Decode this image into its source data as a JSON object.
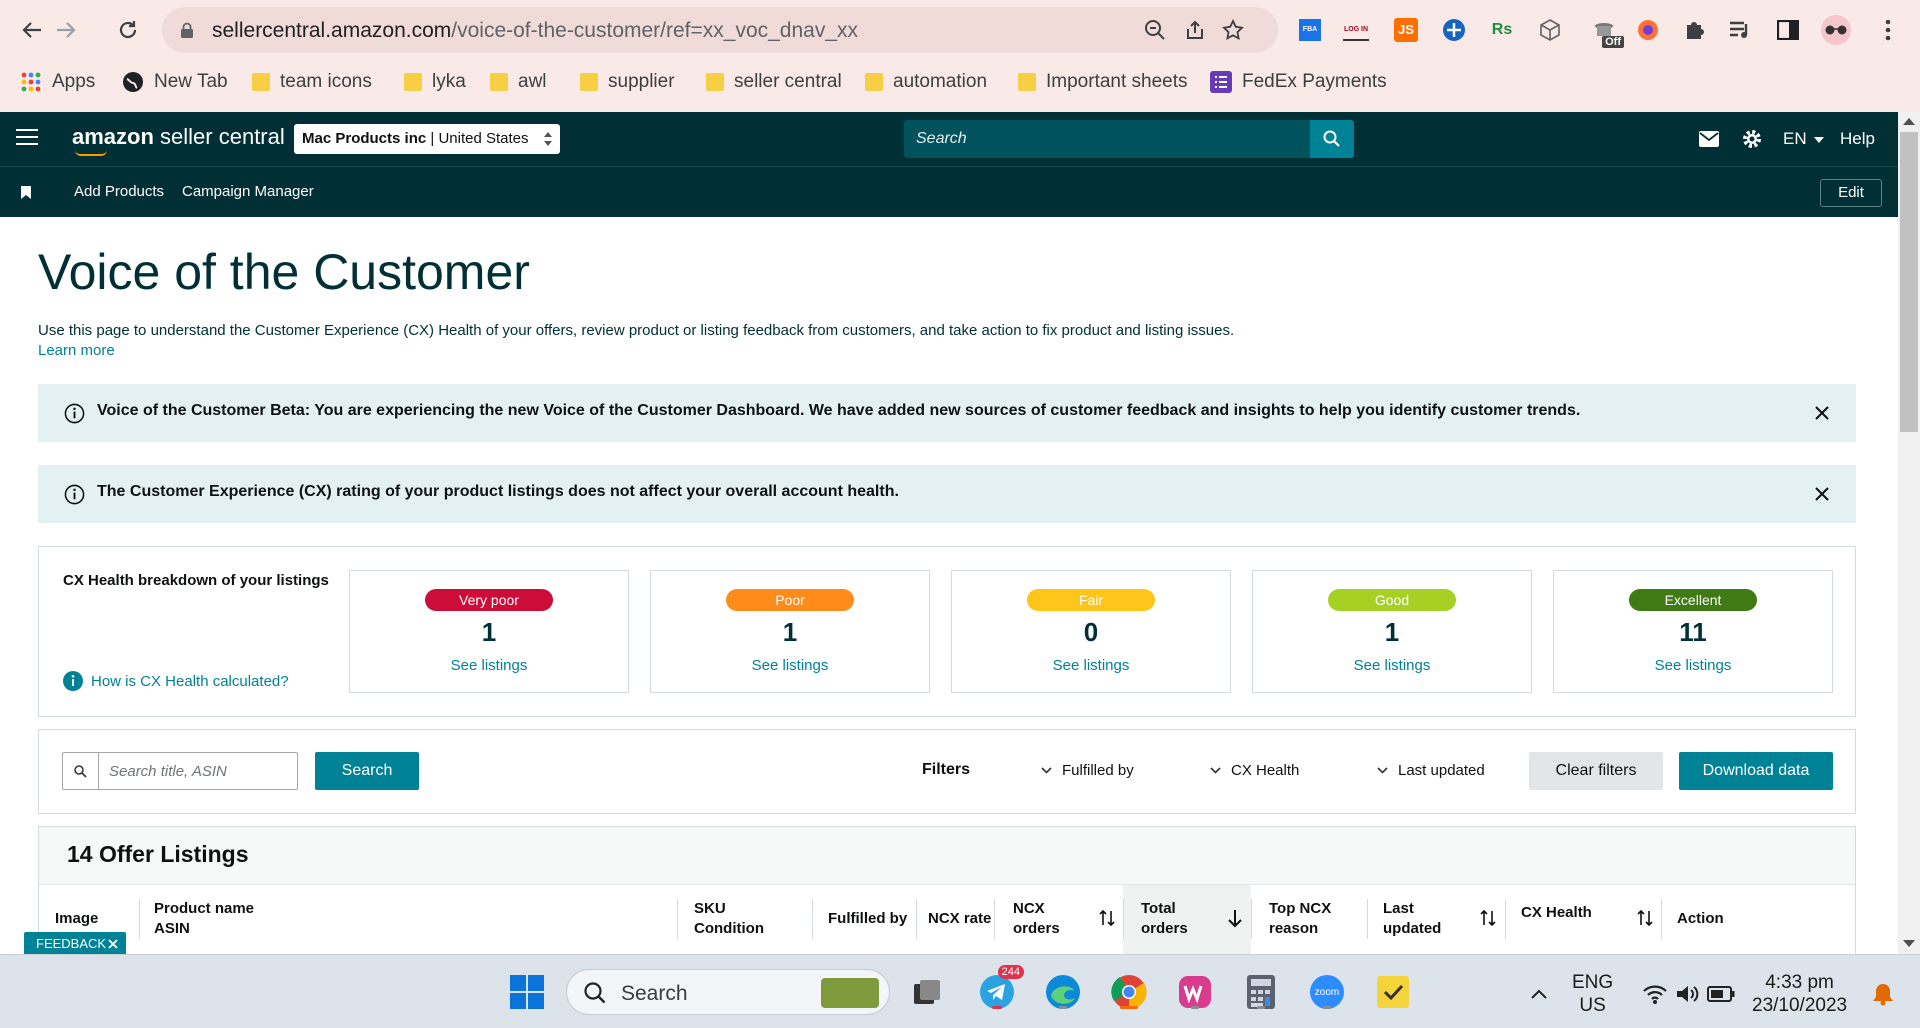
{
  "browser": {
    "url_main": "sellercentral.amazon.com",
    "url_path": "/voice-of-the-customer/ref=xx_voc_dnav_xx",
    "extensions": [
      {
        "name": "fba-extension-icon",
        "label": "FBA",
        "color": "#1a73e8"
      },
      {
        "name": "login-extension-icon",
        "label": "LOG IN",
        "color": "#b00020"
      },
      {
        "name": "js-extension-icon",
        "label": "JS",
        "color": "#ff6f00"
      },
      {
        "name": "rs-extension-icon",
        "label": "Rs",
        "color": "#1e8e3e"
      }
    ],
    "off_badge": "Off",
    "bookmarks": [
      "Apps",
      "New Tab",
      "team icons",
      "lyka",
      "awl",
      "supplier",
      "seller central",
      "automation",
      "Important sheets",
      "FedEx Payments"
    ]
  },
  "header": {
    "logo_brand": "amazon",
    "logo_rest": " seller central",
    "account_name": "Mac Products inc",
    "account_sep": " | ",
    "account_region": "United States",
    "search_placeholder": "Search",
    "language": "EN",
    "help": "Help",
    "subnav": [
      "Add Products",
      "Campaign Manager"
    ],
    "edit": "Edit"
  },
  "page": {
    "title": "Voice of the Customer",
    "intro": "Use this page to understand the Customer Experience (CX) Health of your offers, review product or listing feedback from customers, and take action to fix product and listing issues.",
    "learn_more": "Learn more",
    "banner1": "Voice of the Customer Beta: You are experiencing the new Voice of the Customer Dashboard. We have added new sources of customer feedback and insights to help you identify customer trends.",
    "banner2": "The Customer Experience (CX) rating of your product listings does not affect your overall account health."
  },
  "cx_health": {
    "title": "CX Health breakdown of your listings",
    "how_link": "How is CX Health calculated?",
    "cards": [
      {
        "label": "Very poor",
        "count": "1",
        "link": "See listings",
        "color": "#cc0c39"
      },
      {
        "label": "Poor",
        "count": "1",
        "link": "See listings",
        "color": "#ff8c1a"
      },
      {
        "label": "Fair",
        "count": "0",
        "link": "See listings",
        "color": "#ffc51a"
      },
      {
        "label": "Good",
        "count": "1",
        "link": "See listings",
        "color": "#a6d124"
      },
      {
        "label": "Excellent",
        "count": "11",
        "link": "See listings",
        "color": "#3f7a14"
      }
    ]
  },
  "filters": {
    "search_placeholder": "Search title, ASIN",
    "search_button": "Search",
    "label": "Filters",
    "dropdowns": [
      "Fulfilled by",
      "CX Health",
      "Last updated"
    ],
    "clear": "Clear filters",
    "download": "Download data"
  },
  "listings": {
    "title": "14 Offer Listings",
    "columns": {
      "image": "Image",
      "product_name": "Product name",
      "asin": "ASIN",
      "sku": "SKU",
      "condition": "Condition",
      "fulfilled_by": "Fulfilled by",
      "ncx_rate": "NCX rate",
      "ncx": "NCX",
      "ncx_orders": "orders",
      "total": "Total",
      "total_orders": "orders",
      "top_ncx": "Top NCX",
      "reason": "reason",
      "last": "Last",
      "updated": "updated",
      "cx_health": "CX Health",
      "action": "Action"
    }
  },
  "feedback_tab": "FEEDBACK",
  "taskbar": {
    "search": "Search",
    "telegram_badge": "244",
    "lang_line1": "ENG",
    "lang_line2": "US",
    "time": "4:33 pm",
    "date": "23/10/2023",
    "zoom_label": "zoom"
  }
}
